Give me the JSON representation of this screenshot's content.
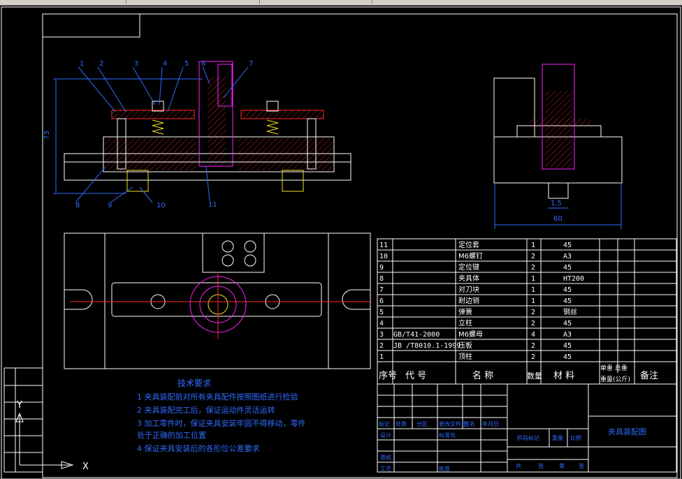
{
  "window": {
    "title": ""
  },
  "leaders": [
    "1",
    "2",
    "3",
    "4",
    "5",
    "6",
    "7",
    "8",
    "9",
    "10",
    "11"
  ],
  "dims": {
    "height_label": "73",
    "width_label": "60",
    "small_label": "1.5"
  },
  "parts_list": {
    "rows": [
      {
        "no": "11",
        "code": "",
        "name": "定位套",
        "qty": "1",
        "mat": "45"
      },
      {
        "no": "10",
        "code": "",
        "name": "M6螺钉",
        "qty": "2",
        "mat": "A3"
      },
      {
        "no": "9",
        "code": "",
        "name": "定位键",
        "qty": "2",
        "mat": "45"
      },
      {
        "no": "8",
        "code": "",
        "name": "夹具体",
        "qty": "1",
        "mat": "HT200"
      },
      {
        "no": "7",
        "code": "",
        "name": "对刀块",
        "qty": "1",
        "mat": "45"
      },
      {
        "no": "6",
        "code": "",
        "name": "耐边销",
        "qty": "1",
        "mat": "45"
      },
      {
        "no": "5",
        "code": "",
        "name": "弹簧",
        "qty": "2",
        "mat": "钢丝"
      },
      {
        "no": "4",
        "code": "",
        "name": "立柱",
        "qty": "2",
        "mat": "45"
      },
      {
        "no": "3",
        "code": "GB/T41-2000",
        "name": "M6螺母",
        "qty": "4",
        "mat": "A3"
      },
      {
        "no": "2",
        "code": "JB /T8010.1-1999",
        "name": "压板",
        "qty": "2",
        "mat": "45"
      },
      {
        "no": "1",
        "code": "",
        "name": "顶柱",
        "qty": "2",
        "mat": "45"
      }
    ],
    "header": {
      "no": "序号",
      "code": "代 号",
      "name": "名 称",
      "qty": "数量",
      "mat": "材 料",
      "weight": "单重 总重",
      "weight2": "重量(公斤)",
      "remark": "备注"
    }
  },
  "tech": {
    "title": "技术要求",
    "items": [
      "1  夹具装配前对所有夹具配件按照图纸进行检验",
      "2  夹具装配完工后，保证运动件灵活运转",
      "3  加工零件时，保证夹具安装牢固不得移动，零件",
      "    处于正确的加工位置",
      "4  保证夹具安装后的各形位公差要求"
    ]
  },
  "title_block": {
    "drawing_name": "夹具装配图",
    "cells": [
      "标记",
      "处数",
      "分区",
      "更改文件号",
      "签名",
      "年月日",
      "设计",
      "标准化",
      "审核",
      "工艺",
      "批准",
      "阶段标记",
      "重量",
      "比例",
      "共",
      "张",
      "第",
      "张"
    ]
  },
  "ucs": {
    "x_label": "X",
    "y_label": "Y"
  },
  "colors": {
    "background": "#000000",
    "lines": "#ffffff",
    "magenta": "#ff20ff",
    "red": "#ff2a2a",
    "blue": "#2f6bff",
    "yellow": "#f0e020"
  }
}
